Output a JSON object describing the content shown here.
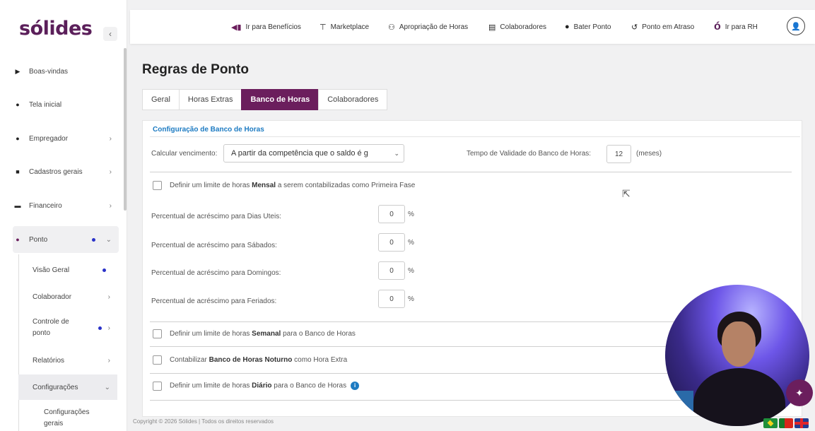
{
  "brand": {
    "logo": "sólides",
    "accent": "#6b1e5d",
    "link_color": "#1d7bc2"
  },
  "sidebar": {
    "collapse_icon": "‹",
    "items": [
      {
        "label": "Boas-vindas",
        "icon": "play-icon"
      },
      {
        "label": "Tela inicial",
        "icon": "info-icon"
      },
      {
        "label": "Empregador",
        "icon": "user-circle-icon"
      },
      {
        "label": "Cadastros gerais",
        "icon": "square-icon"
      },
      {
        "label": "Financeiro",
        "icon": "card-icon"
      },
      {
        "label": "Ponto",
        "icon": "clock-icon"
      }
    ],
    "sub_items": [
      {
        "label": "Visão Geral"
      },
      {
        "label": "Colaborador"
      },
      {
        "label": "Controle de ponto"
      },
      {
        "label": "Relatórios"
      },
      {
        "label": "Configurações"
      },
      {
        "label": "Configurações gerais"
      }
    ]
  },
  "topbar": {
    "links": [
      {
        "label": "Ir para Benefícios",
        "icon": "megaphone-icon"
      },
      {
        "label": "Marketplace",
        "icon": "cart-icon"
      },
      {
        "label": "Apropriação de Horas",
        "icon": "users-icon"
      },
      {
        "label": "Colaboradores",
        "icon": "id-card-icon"
      },
      {
        "label": "Bater Ponto",
        "icon": "clock-icon"
      },
      {
        "label": "Ponto em Atraso",
        "icon": "history-icon"
      },
      {
        "label": "Ir para RH",
        "icon": "solides-icon"
      }
    ]
  },
  "page": {
    "title": "Regras de Ponto",
    "tabs": [
      {
        "label": "Geral"
      },
      {
        "label": "Horas Extras"
      },
      {
        "label": "Banco de Horas"
      },
      {
        "label": "Colaboradores"
      }
    ],
    "active_tab": "Banco de Horas"
  },
  "config": {
    "section_title": "Configuração de Banco de Horas",
    "calc_label": "Calcular vencimento:",
    "calc_value": "A partir da competência que o saldo é g",
    "validity_label": "Tempo de Validade do Banco de Horas:",
    "validity_value": "12",
    "validity_unit": "(meses)",
    "monthly_limit": {
      "pre": "Definir um limite de horas ",
      "bold": "Mensal",
      "post": " a serem contabilizadas como Primeira Fase"
    },
    "percentages": [
      {
        "label": "Percentual de acréscimo para Dias Uteis:",
        "value": "0",
        "unit": "%"
      },
      {
        "label": "Percentual de acréscimo para Sábados:",
        "value": "0",
        "unit": "%"
      },
      {
        "label": "Percentual de acréscimo para Domingos:",
        "value": "0",
        "unit": "%"
      },
      {
        "label": "Percentual de acréscimo para Feriados:",
        "value": "0",
        "unit": "%"
      }
    ],
    "weekly_limit": {
      "pre": "Definir um limite de horas ",
      "bold": "Semanal",
      "post": " para o Banco de Horas"
    },
    "nocturnal": {
      "pre": "Contabilizar ",
      "bold": "Banco de Horas Noturno",
      "post": " como Hora Extra"
    },
    "daily_limit": {
      "pre": "Definir um limite de horas ",
      "bold": "Diário",
      "post": " para o Banco de Horas"
    }
  },
  "footer": {
    "text": "Copyright © 2026 Sólides | Todos os direitos reservados"
  },
  "profile": {
    "icon": "person-icon"
  }
}
